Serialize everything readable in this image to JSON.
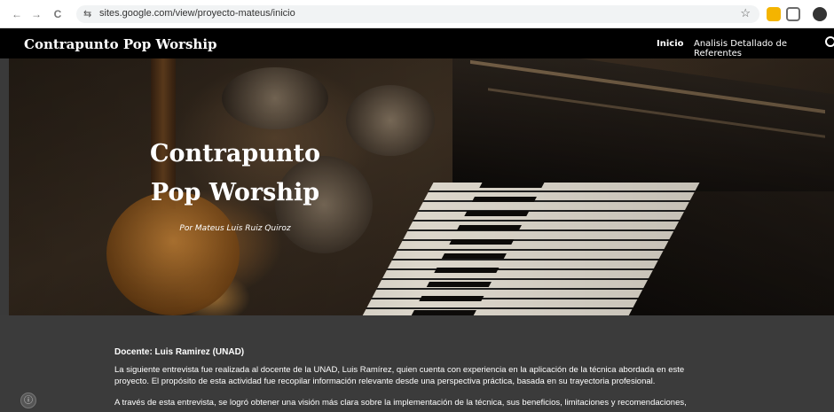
{
  "browser": {
    "back_icon": "←",
    "forward_icon": "→",
    "reload_icon": "C",
    "tune_icon": "⇆",
    "url": "sites.google.com/view/proyecto-mateus/inicio",
    "bookmark_icon": "☆",
    "colors": {
      "ext_yellow": "#f4b400",
      "ext_gray": "#6b6b6b"
    }
  },
  "site": {
    "title": "Contrapunto Pop Worship",
    "nav": [
      {
        "label": "Inicio",
        "active": true
      },
      {
        "label": "Analisis Detallado de Referentes",
        "active": false
      }
    ]
  },
  "hero": {
    "title_line1": "Contrapunto",
    "title_line2": "Pop Worship",
    "subtitle": "Por Mateus Luis Ruiz Quiroz"
  },
  "content": {
    "heading": "Docente: Luis Ramirez (UNAD)",
    "para1_line1": "La siguiente entrevista fue realizada al docente de la UNAD, Luis Ramírez, quien cuenta con experiencia en la aplicación de la técnica abordada en este",
    "para1_line2": "proyecto. El propósito de esta actividad fue recopilar información relevante desde una perspectiva práctica, basada en su trayectoria profesional.",
    "para2_line1": "A través de esta entrevista, se logró obtener una visión más clara sobre la implementación de la técnica, sus beneficios, limitaciones y recomendaciones,"
  },
  "info_button": "ⓘ"
}
